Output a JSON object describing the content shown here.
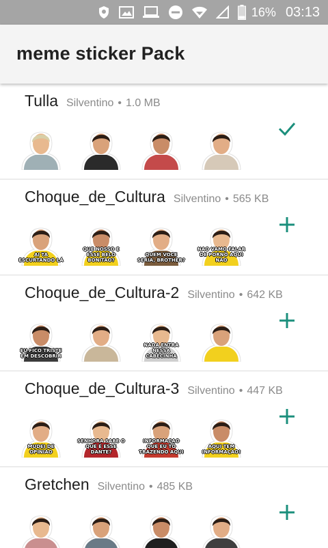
{
  "status_bar": {
    "battery": "16%",
    "time": "03:13",
    "icons": [
      "vpn-shield-icon",
      "image-icon",
      "laptop-icon",
      "do-not-disturb-icon",
      "wifi-icon",
      "cell-signal-icon",
      "battery-icon"
    ]
  },
  "app_bar": {
    "title": "meme sticker Pack"
  },
  "colors": {
    "accent": "#1b8f7c",
    "status_bar": "#a5a5a5",
    "app_bar": "#f4f4f4"
  },
  "packs": [
    {
      "name": "Tulla",
      "author": "Silventino",
      "separator": "•",
      "size": "1.0 MB",
      "action": "check-icon",
      "stickers": [
        {
          "caption": ""
        },
        {
          "caption": ""
        },
        {
          "caption": ""
        },
        {
          "caption": ""
        }
      ]
    },
    {
      "name": "Choque_de_Cultura",
      "author": "Silventino",
      "separator": "•",
      "size": "565 KB",
      "action": "plus-icon",
      "stickers": [
        {
          "caption": "AÍ TÁ ESCURTANDO LÁ"
        },
        {
          "caption": "QUE NOSSO É ESSE BELO BONITÃO?"
        },
        {
          "caption": "QUEM VOCÊ SERIA, BROTHER?"
        },
        {
          "caption": "NÃO VAMO FALAR DE PORNÔ AQUI NÃO"
        }
      ]
    },
    {
      "name": "Choque_de_Cultura-2",
      "author": "Silventino",
      "separator": "•",
      "size": "642 KB",
      "action": "plus-icon",
      "stickers": [
        {
          "caption": "EU FICO TRISTE EM DESCOBRIR"
        },
        {
          "caption": ""
        },
        {
          "caption": "NADA ENTRA NESSA CABECINHA DEZINHA AÍ"
        },
        {
          "caption": ""
        }
      ]
    },
    {
      "name": "Choque_de_Cultura-3",
      "author": "Silventino",
      "separator": "•",
      "size": "447 KB",
      "action": "plus-icon",
      "stickers": [
        {
          "caption": "MUDEI DE OPINIÃO"
        },
        {
          "caption": "SENHORA SABE O QUE É ESSE DANTE?"
        },
        {
          "caption": "INFORMAÇÃO QUE EU TÔ TRAZENDO AQUI"
        },
        {
          "caption": "AQUI TEM INFORMAÇÃO!"
        }
      ]
    },
    {
      "name": "Gretchen",
      "author": "Silventino",
      "separator": "•",
      "size": "485 KB",
      "action": "plus-icon",
      "stickers": [
        {
          "caption": ""
        },
        {
          "caption": ""
        },
        {
          "caption": ""
        },
        {
          "caption": ""
        }
      ]
    }
  ]
}
